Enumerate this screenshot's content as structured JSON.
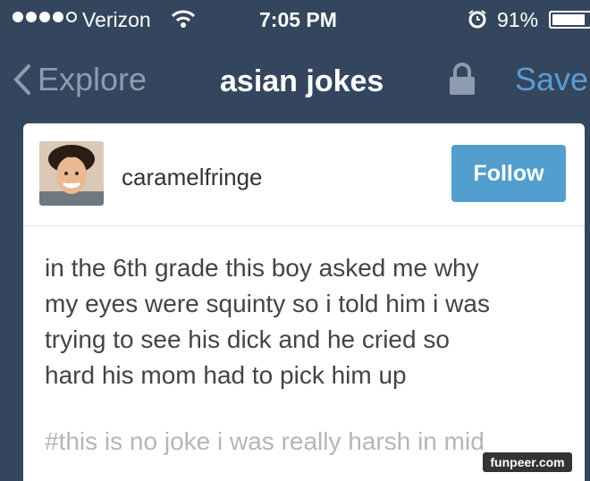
{
  "status_bar": {
    "carrier": "Verizon",
    "time": "7:05 PM",
    "battery_pct": "91%",
    "battery_level": 0.91,
    "signal_bars": 4
  },
  "nav": {
    "back_label": "Explore",
    "title": "asian jokes",
    "save_label": "Save"
  },
  "post": {
    "username": "caramelfringe",
    "follow_label": "Follow",
    "lines": [
      "in the 6th grade this boy asked me why",
      "my eyes were squinty so i told him i was",
      "trying to see his dick and he cried so",
      "hard his mom had to pick him up"
    ],
    "tags": "#this is no joke i was really harsh in mid"
  },
  "watermark": "funpeer.com",
  "colors": {
    "background": "#34465d",
    "follow_button": "#529ecc",
    "save_link": "#5b9bd5"
  }
}
